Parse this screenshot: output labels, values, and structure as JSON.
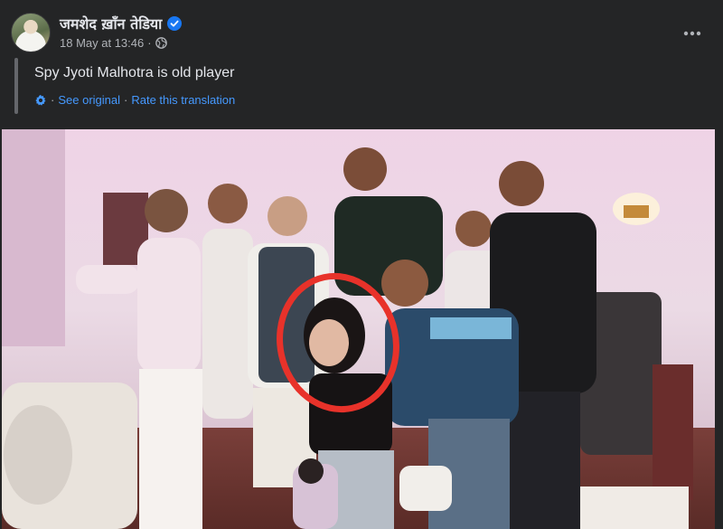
{
  "post": {
    "author": "जमशेद ख़ाँन तेडिया",
    "date": "18 May at 13:46",
    "separator": "·",
    "text": "Spy Jyoti Malhotra is old player",
    "see_original": "See original",
    "rate_translation": "Rate this translation",
    "dot": "·"
  },
  "icons": {
    "verified": "verified-badge-icon",
    "audience": "globe-icon",
    "translate": "gear-icon",
    "more": "more-horizontal-icon"
  },
  "colors": {
    "background": "#242526",
    "text_primary": "#e4e6eb",
    "text_secondary": "#b0b3b8",
    "link": "#4599ff",
    "verified": "#1877f2",
    "annotation_circle": "#e8322a"
  }
}
